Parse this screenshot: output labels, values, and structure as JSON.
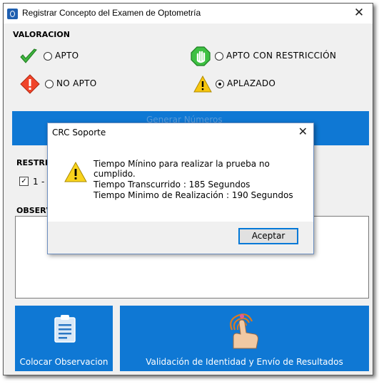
{
  "window": {
    "title": "Registrar Concepto del Examen de Optometría",
    "close_glyph": "✕"
  },
  "valoracion": {
    "heading": "VALORACION",
    "options": [
      {
        "label": "APTO",
        "icon": "checkmark-icon",
        "selected": false
      },
      {
        "label": "APTO CON RESTRICCIÓN",
        "icon": "hand-stop-icon",
        "selected": false
      },
      {
        "label": "NO APTO",
        "icon": "red-diamond-warning-icon",
        "selected": false
      },
      {
        "label": "APLAZADO",
        "icon": "yellow-warning-icon",
        "selected": true
      }
    ]
  },
  "background": {
    "generate_button_ghost": "Generar Números",
    "restricciones_heading": "RESTRIC",
    "restriccion_item": "1 -",
    "observaciones_heading": "OBSERV"
  },
  "buttons": {
    "colocar": "Colocar Observacion",
    "validacion": "Validación de Identidad y Envío de Resultados"
  },
  "dialog": {
    "title": "CRC Soporte",
    "close_glyph": "✕",
    "message": "Tiempo Mínino para realizar la prueba no cumplido.",
    "line1": "Tiempo Transcurrido : 185 Segundos",
    "line2": "Tiempo Minimo de Realización : 190 Segundos",
    "ok": "Aceptar"
  },
  "colors": {
    "accent_blue": "#0f78d4",
    "dialog_border": "#6c8ebf"
  }
}
